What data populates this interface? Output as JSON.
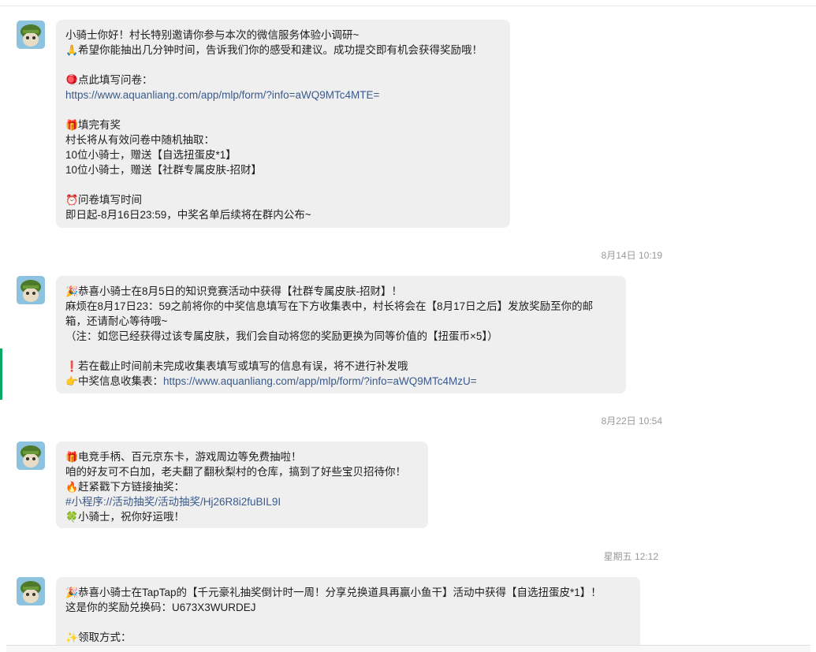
{
  "messages": [
    {
      "lines": [
        {
          "text": "小骑士你好！村长特别邀请你参与本次的微信服务体验小调研~"
        },
        {
          "emoji": "🙏",
          "text": "希望你能抽出几分钟时间，告诉我们你的感受和建议。成功提交即有机会获得奖励哦！"
        },
        {
          "blank": true
        },
        {
          "emoji": "🪀",
          "text": "点此填写问卷："
        },
        {
          "link": "https://www.aquanliang.com/app/mlp/form/?info=aWQ9MTc4MTE="
        },
        {
          "blank": true
        },
        {
          "emoji": "🎁",
          "text": "填完有奖"
        },
        {
          "text": "村长将从有效问卷中随机抽取："
        },
        {
          "text": "10位小骑士，赠送【自选扭蛋皮*1】"
        },
        {
          "text": "10位小骑士，赠送【社群专属皮肤-招财】"
        },
        {
          "blank": true
        },
        {
          "emoji": "⏰",
          "text": "问卷填写时间"
        },
        {
          "text": "即日起-8月16日23:59，中奖名单后续将在群内公布~"
        }
      ]
    },
    {
      "timestamp": "8月14日 10:19",
      "lines": [
        {
          "emoji": "🎉",
          "text": "恭喜小骑士在8月5日的知识竞赛活动中获得【社群专属皮肤-招财】！"
        },
        {
          "text": "麻烦在8月17日23：59之前将你的中奖信息填写在下方收集表中，村长将会在【8月17日之后】发放奖励至你的邮"
        },
        {
          "text": "箱，还请耐心等待哦~"
        },
        {
          "text": "（注：如您已经获得过该专属皮肤，我们会自动将您的奖励更换为同等价值的【扭蛋币×5】）"
        },
        {
          "blank": true
        },
        {
          "emoji": "❗",
          "text": "若在截止时间前未完成收集表填写或填写的信息有误，将不进行补发哦"
        },
        {
          "emoji": "👉",
          "text": "中奖信息收集表：",
          "link": "https://www.aquanliang.com/app/mlp/form/?info=aWQ9MTc4MzU="
        }
      ]
    },
    {
      "timestamp": "8月22日 10:54",
      "lines": [
        {
          "emoji": "🎁",
          "text": "电竞手柄、百元京东卡，游戏周边等免费抽啦！"
        },
        {
          "text": "咱的好友可不白加，老夫翻了翻秋梨村的仓库，搞到了好些宝贝招待你！"
        },
        {
          "emoji": "🔥",
          "text": "赶紧戳下方链接抽奖："
        },
        {
          "link": "#小程序://活动抽奖/活动抽奖/Hj26R8i2fuBIL9I"
        },
        {
          "emoji": "🍀",
          "text": "小骑士，祝你好运哦！"
        }
      ]
    },
    {
      "timestamp": "星期五 12:12",
      "lines": [
        {
          "emoji": "🎉",
          "text": "恭喜小骑士在TapTap的【千元豪礼抽奖倒计时一周！分享兑换道具再赢小鱼干】活动中获得【自选扭蛋皮*1】！"
        },
        {
          "text": "这是你的奖励兑换码：U673X3WURDEJ"
        },
        {
          "blank": true
        },
        {
          "emoji": "✨",
          "text": "领取方式："
        }
      ]
    }
  ]
}
